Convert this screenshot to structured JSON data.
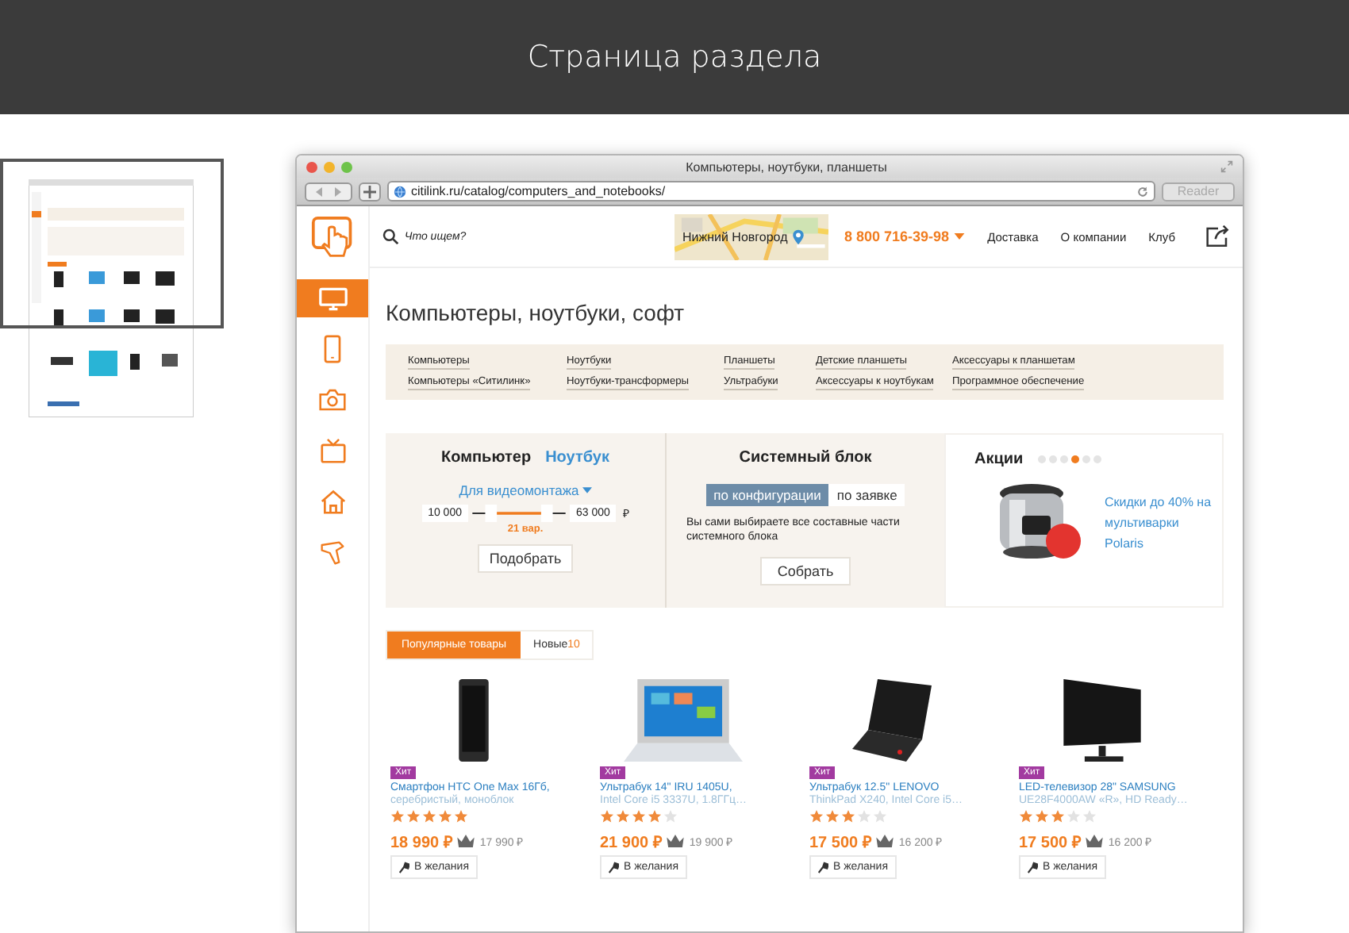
{
  "header": {
    "title": "Страница раздела"
  },
  "browser": {
    "title": "Компьютеры, ноутбуки, планшеты",
    "url": "citilink.ru/catalog/computers_and_notebooks/",
    "reader": "Reader"
  },
  "sidebar": [
    {
      "kind": "monitor",
      "selected": true
    },
    {
      "kind": "phone",
      "selected": false
    },
    {
      "kind": "camera",
      "selected": false
    },
    {
      "kind": "tv",
      "selected": false
    },
    {
      "kind": "home",
      "selected": false
    },
    {
      "kind": "hairdryer",
      "selected": false
    }
  ],
  "topbar": {
    "search_placeholder": "Что ищем?",
    "city": "Нижний Новгород",
    "phone": "8 800 716-39-98",
    "links": [
      "Доставка",
      "О компании",
      "Клуб"
    ]
  },
  "heading": "Компьютеры, ноутбуки, софт",
  "categories": [
    [
      "Компьютеры",
      "Компьютеры «Ситилинк»"
    ],
    [
      "Ноутбуки",
      "Ноутбуки-трансформеры"
    ],
    [
      "Планшеты",
      "Ультрабуки"
    ],
    [
      "Детские планшеты",
      "Аксессуары к ноутбукам"
    ],
    [
      "Аксессуары к планшетам",
      "Программное обеспечение"
    ]
  ],
  "configurator": {
    "tabs": [
      {
        "label": "Компьютер",
        "selected": true
      },
      {
        "label": "Ноутбук",
        "selected": false
      }
    ],
    "preset": "Для видеомонтажа",
    "slider": {
      "low": {
        "level": 0.2
      },
      "high": {
        "level": 0.8
      }
    },
    "min": "10 000",
    "max": "63 000",
    "currency": "₽",
    "variants": "21 вар.",
    "button": "Подобрать"
  },
  "system_block": {
    "title": "Системный блок",
    "modes": [
      {
        "label": "по конфигурации",
        "selected": true
      },
      {
        "label": "по заявке",
        "selected": false
      }
    ],
    "description": "Вы сами выбираете все составные части системного блока",
    "button": "Собрать"
  },
  "promo": {
    "title": "Акции",
    "dots": [
      {
        "selected": false
      },
      {
        "selected": false
      },
      {
        "selected": false
      },
      {
        "selected": true
      },
      {
        "selected": false
      },
      {
        "selected": false
      }
    ],
    "link": "Скидки до 40% на мультиварки Polaris"
  },
  "product_tabs": [
    {
      "label": "Популярные товары",
      "selected": true
    },
    {
      "label": "Новые",
      "count": "10",
      "selected": false
    }
  ],
  "products": [
    {
      "kind": "phone",
      "badge": "Хит",
      "name": "Смартфон HTC One Max 16Гб,",
      "details": "серебристый, моноблок",
      "stars": 5,
      "price": "18 990 ₽",
      "club_price": "17 990 ₽",
      "wish": "В желания"
    },
    {
      "kind": "laptop",
      "badge": "Хит",
      "name": "Ультрабук 14\" IRU 1405U,",
      "details": "Intel Core i5 3337U, 1.8ГГц…",
      "stars": 4,
      "price": "21 900 ₽",
      "club_price": "19 900 ₽",
      "wish": "В желания"
    },
    {
      "kind": "black-laptop",
      "badge": "Хит",
      "name": "Ультрабук 12.5\" LENOVO",
      "details": "ThinkPad X240, Intel Core i5…",
      "stars": 3,
      "price": "17 500 ₽",
      "club_price": "16 200 ₽",
      "wish": "В желания"
    },
    {
      "kind": "tv",
      "badge": "Хит",
      "name": "LED-телевизор 28\" SAMSUNG",
      "details": "UE28F4000AW «R», HD Ready…",
      "stars": 3,
      "price": "17 500 ₽",
      "club_price": "16 200 ₽",
      "wish": "В желания"
    }
  ]
}
